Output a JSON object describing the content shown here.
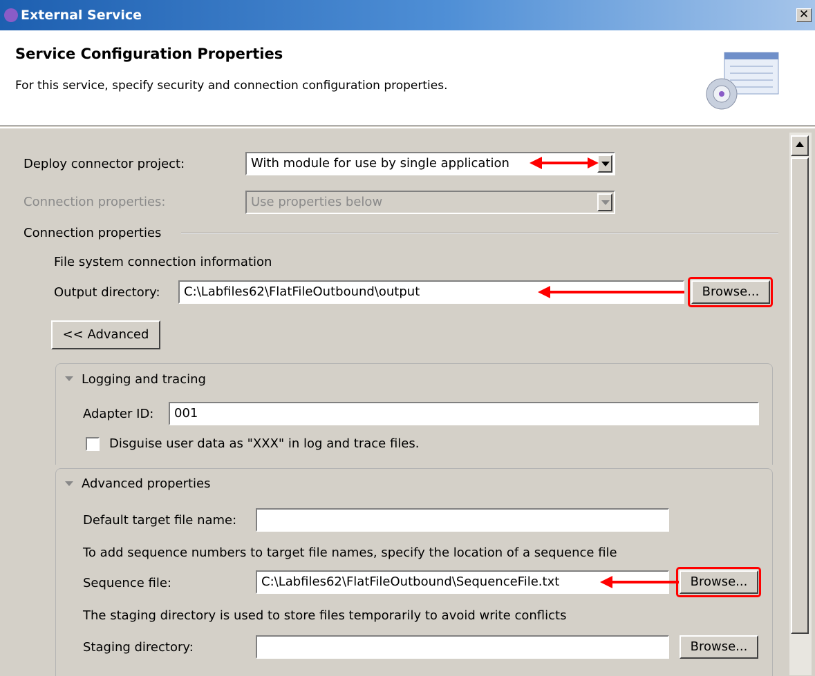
{
  "window": {
    "title": "External Service",
    "close_label": "✕"
  },
  "header": {
    "title": "Service Configuration Properties",
    "subtitle": "For this service, specify security and connection configuration properties."
  },
  "deploy": {
    "label": "Deploy connector project:",
    "value": "With module for use by single application"
  },
  "connection_select": {
    "label": "Connection properties:",
    "value": "Use properties below"
  },
  "connection_group": {
    "label": "Connection properties"
  },
  "file_system": {
    "heading": "File system connection information",
    "output_label": "Output directory:",
    "output_value": "C:\\Labfiles62\\FlatFileOutbound\\output",
    "browse_label": "Browse..."
  },
  "advanced_button": {
    "label": "<< Advanced"
  },
  "logging": {
    "title": "Logging and tracing",
    "adapter_label": "Adapter ID:",
    "adapter_value": "001",
    "disguise_label": "Disguise user data as \"XXX\" in log and trace files."
  },
  "advanced_props": {
    "title": "Advanced properties",
    "default_target_label": "Default target file name:",
    "default_target_value": "",
    "sequence_note": "To add sequence numbers to target file names, specify the location of a sequence file",
    "sequence_label": "Sequence file:",
    "sequence_value": "C:\\Labfiles62\\FlatFileOutbound\\SequenceFile.txt",
    "sequence_browse": "Browse...",
    "staging_note": "The staging directory is used to store files temporarily to avoid write conflicts",
    "staging_label": "Staging directory:",
    "staging_value": "",
    "staging_browse": "Browse..."
  },
  "colors": {
    "annotation": "#ff0000",
    "dialog_bg": "#d4d0c8",
    "titlebar": "#1d5fb0"
  },
  "icons": [
    "app-icon",
    "close-icon",
    "wizard-graphic",
    "dropdown-arrow-icon",
    "expand-triangle-icon",
    "scroll-up-icon"
  ]
}
